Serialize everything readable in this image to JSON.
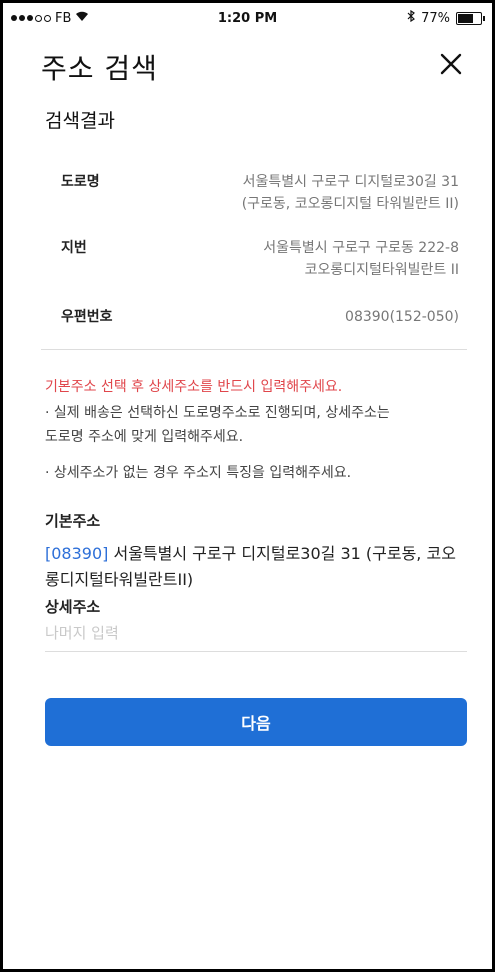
{
  "status_bar": {
    "carrier": "FB",
    "time": "1:20 PM",
    "battery": "77%",
    "battery_level": 0.77
  },
  "header": {
    "title": "주소 검색",
    "close_icon": "close-icon"
  },
  "results": {
    "title": "검색결과",
    "road_label": "도로명",
    "road_value_line1": "서울특별시 구로구 디지털로30길 31",
    "road_value_line2": "(구로동, 코오롱디지털 타워빌란트 II)",
    "jibun_label": "지번",
    "jibun_value_line1": "서울특별시 구로구 구로동 222-8",
    "jibun_value_line2": "코오롱디지털타워빌란트 II",
    "postal_label": "우편번호",
    "postal_value": "08390(152-050)"
  },
  "notices": {
    "warning": "기본주소 선택 후 상세주소를 반드시 입력해주세요.",
    "info1_line1": "· 실제 배송은 선택하신 도로명주소로 진행되며, 상세주소는",
    "info1_line2": "도로명 주소에 맞게 입력해주세요.",
    "info2": "· 상세주소가 없는 경우 주소지 특징을 입력해주세요."
  },
  "form": {
    "base_label": "기본주소",
    "base_code": "[08390]",
    "base_address": " 서울특별시 구로구 디지털로30길 31 (구로동, 코오롱디지털타워빌란트II)",
    "detail_label": "상세주소",
    "detail_placeholder": "나머지 입력",
    "detail_value": ""
  },
  "actions": {
    "next_label": "다음"
  },
  "colors": {
    "accent": "#1f6fd6",
    "warning": "#e0464b",
    "code": "#2d6fd8"
  }
}
